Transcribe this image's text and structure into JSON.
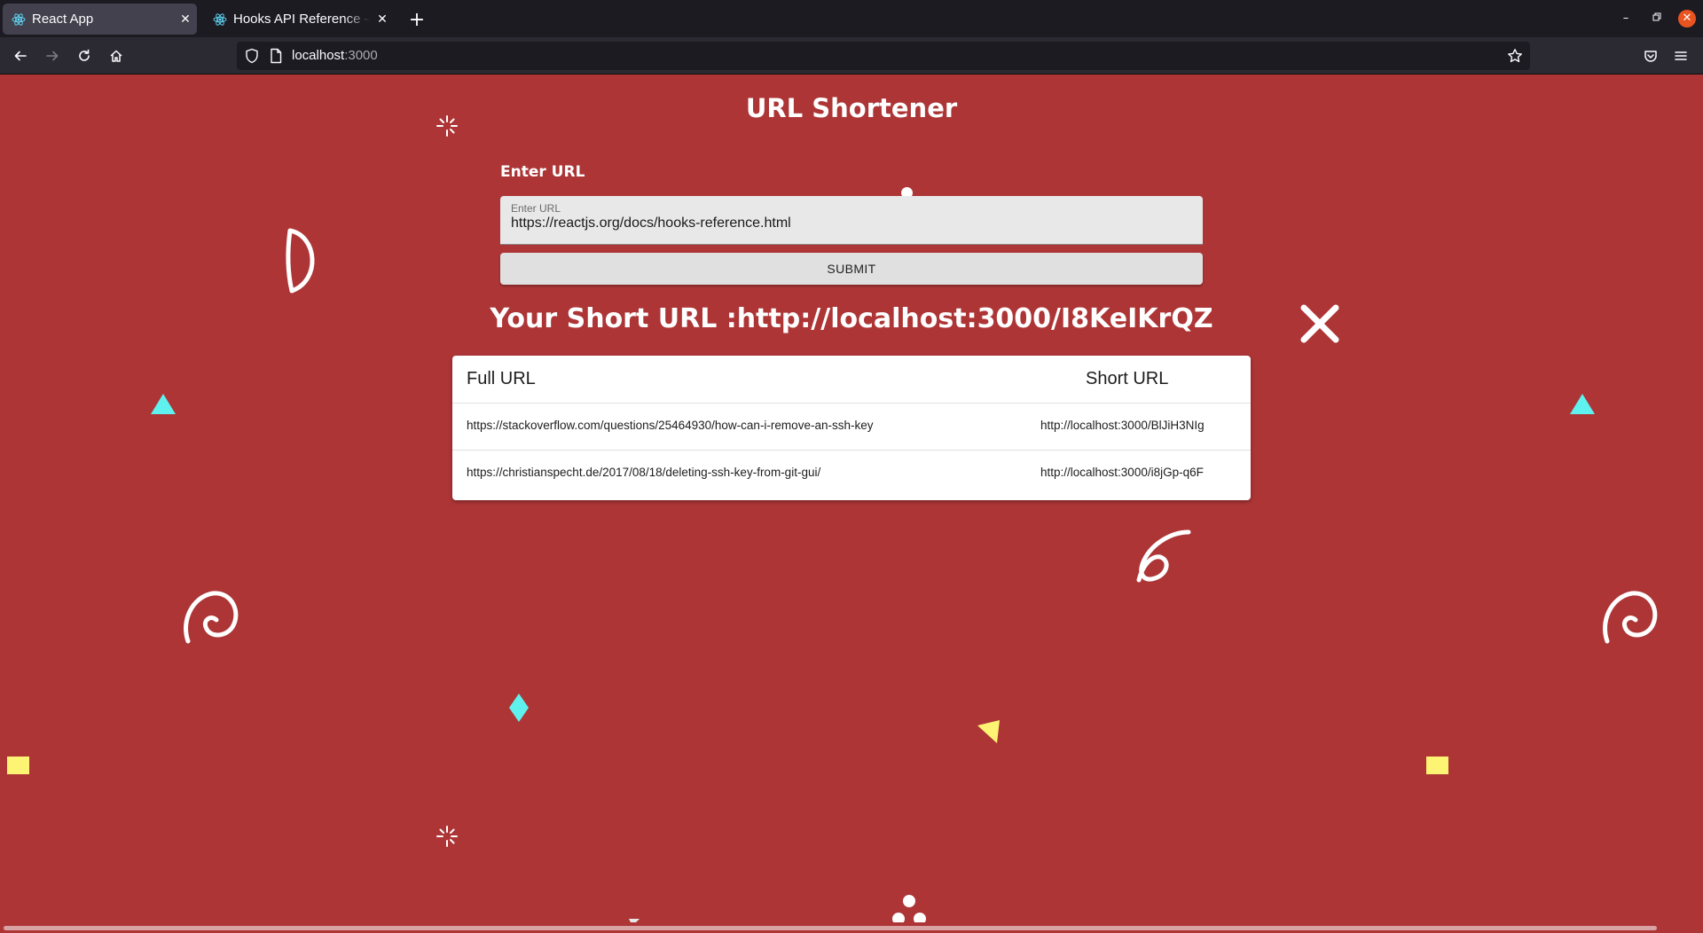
{
  "browser": {
    "tabs": [
      {
        "title": "React App",
        "active": true
      },
      {
        "title": "Hooks API Reference – React",
        "active": false
      }
    ],
    "address": {
      "host": "localhost",
      "port": ":3000"
    }
  },
  "app": {
    "title": "URL Shortener",
    "form": {
      "section_label": "Enter URL",
      "field_label": "Enter URL",
      "field_value": "https://reactjs.org/docs/hooks-reference.html",
      "submit_label": "SUBMIT"
    },
    "short_url_text": "Your Short URL :http://localhost:3000/I8KeIKrQZ",
    "table": {
      "headers": [
        "Full URL",
        "Short URL"
      ],
      "rows": [
        {
          "full": "https://stackoverflow.com/questions/25464930/how-can-i-remove-an-ssh-key",
          "short": "http://localhost:3000/BlJiH3NIg"
        },
        {
          "full": "https://christianspecht.de/2017/08/18/deleting-ssh-key-from-git-gui/",
          "short": "http://localhost:3000/i8jGp-q6F"
        }
      ]
    }
  },
  "colors": {
    "background": "#ad3536",
    "confetti_cyan": "#5ff1ee",
    "confetti_yellow": "#fdf474"
  }
}
